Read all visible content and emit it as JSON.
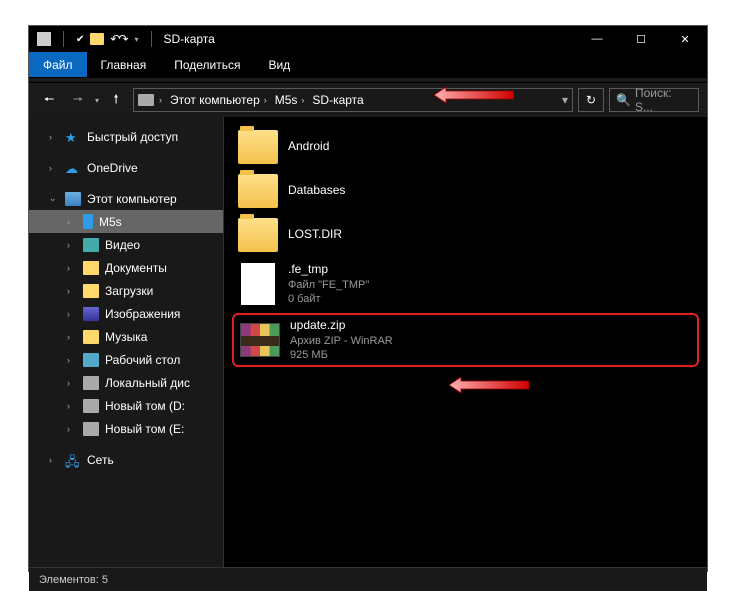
{
  "titlebar": {
    "title": "SD-карта"
  },
  "window_controls": {
    "min": "—",
    "max": "☐",
    "close": "✕"
  },
  "tabs": {
    "file": "Файл",
    "home": "Главная",
    "share": "Поделиться",
    "view": "Вид"
  },
  "breadcrumbs": {
    "pc": "Этот компьютер",
    "m5s": "M5s",
    "sd": "SD-карта"
  },
  "search": {
    "placeholder": "Поиск: S..."
  },
  "sidebar": {
    "quick_access": "Быстрый доступ",
    "onedrive": "OneDrive",
    "this_pc": "Этот компьютер",
    "m5s": "M5s",
    "video": "Видео",
    "documents": "Документы",
    "downloads": "Загрузки",
    "pictures": "Изображения",
    "music": "Музыка",
    "desktop": "Рабочий стол",
    "local_disk": "Локальный дис",
    "new_vol_d": "Новый том (D:",
    "new_vol_e": "Новый том (E:",
    "network": "Сеть"
  },
  "files": {
    "android": {
      "name": "Android"
    },
    "databases": {
      "name": "Databases"
    },
    "lostdir": {
      "name": "LOST.DIR"
    },
    "fetmp": {
      "name": ".fe_tmp",
      "type": "Файл \"FE_TMP\"",
      "size": "0 байт"
    },
    "update": {
      "name": "update.zip",
      "type": "Архив ZIP - WinRAR",
      "size": "925 МБ"
    }
  },
  "status": {
    "elements_label": "Элементов:",
    "count": "5"
  }
}
